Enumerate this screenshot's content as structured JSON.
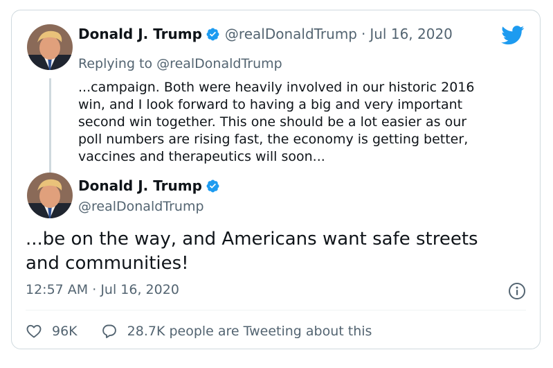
{
  "reply_tweet": {
    "name": "Donald J. Trump",
    "handle": "@realDonaldTrump",
    "separator": "·",
    "date": "Jul 16, 2020",
    "replying_label": "Replying to",
    "replying_handle": "@realDonaldTrump",
    "text_lines": [
      "...campaign. Both were heavily involved in our historic 2016",
      "win, and I look forward to having a big and very important",
      "second win together. This one should be a lot easier as our",
      "poll numbers are rising fast, the economy is getting better,",
      "vaccines and therapeutics will soon..."
    ]
  },
  "main_tweet": {
    "name": "Donald J. Trump",
    "handle": "@realDonaldTrump",
    "text_lines": [
      "...be on the way, and Americans want safe streets",
      "and communities!"
    ],
    "time": "12:57 AM",
    "separator": "·",
    "date": "Jul 16, 2020"
  },
  "actions": {
    "likes": "96K",
    "tweeting": "28.7K people are Tweeting about this"
  },
  "icons": {
    "logo": "twitter-bird-icon",
    "verified": "verified-badge-icon",
    "info": "info-icon",
    "like": "heart-icon",
    "reply": "speech-bubble-icon"
  },
  "colors": {
    "twitter_blue": "#1d9bf0",
    "secondary_text": "#536471",
    "border": "#cfd9de"
  }
}
